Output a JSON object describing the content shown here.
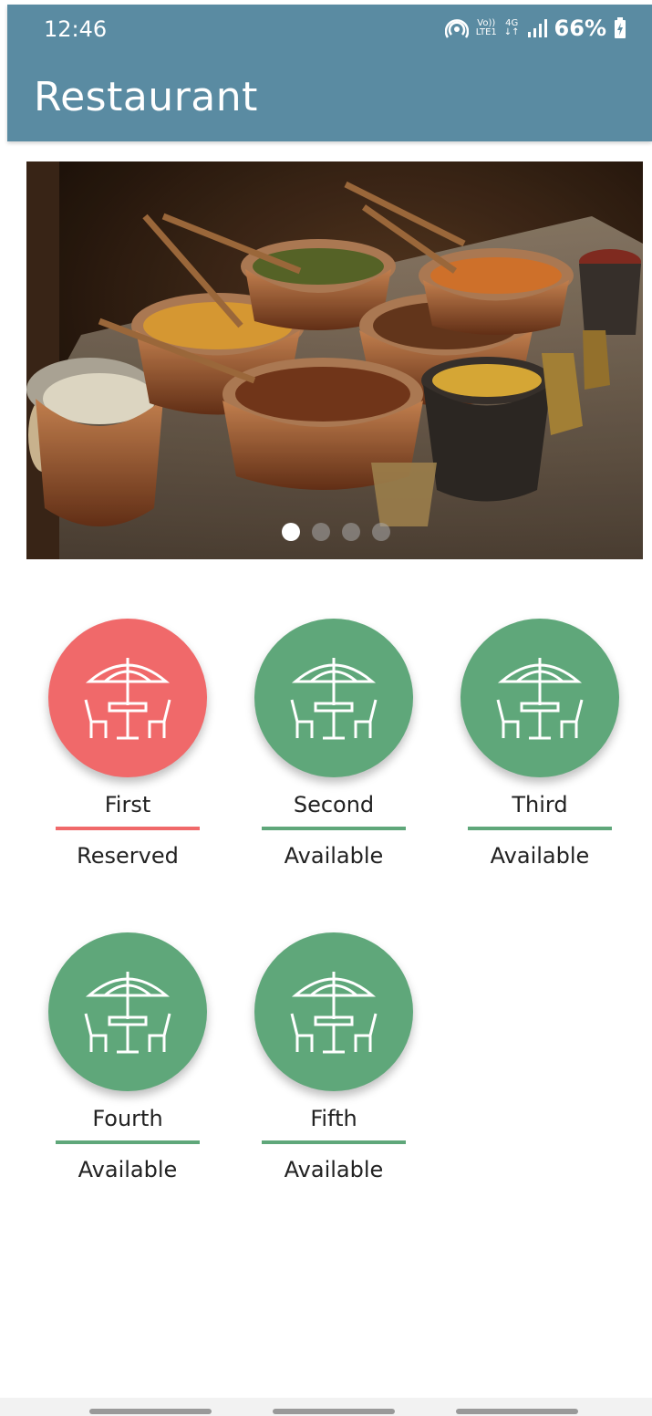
{
  "status_bar": {
    "time": "12:46",
    "volte_label": "Vo))\nLTE1",
    "network_label": "4G",
    "battery_percent": "66%"
  },
  "app_bar": {
    "title": "Restaurant"
  },
  "carousel": {
    "slide_count": 4,
    "active_index": 0,
    "image_subject": "Indian food in copper pots"
  },
  "tables": [
    {
      "name": "First",
      "status": "Reserved",
      "color": "#f0696a"
    },
    {
      "name": "Second",
      "status": "Available",
      "color": "#5fa77a"
    },
    {
      "name": "Third",
      "status": "Available",
      "color": "#5fa77a"
    },
    {
      "name": "Fourth",
      "status": "Available",
      "color": "#5fa77a"
    },
    {
      "name": "Fifth",
      "status": "Available",
      "color": "#5fa77a"
    }
  ],
  "icons": {
    "table": "restaurant-table-umbrella-icon"
  },
  "colors": {
    "appbar": "#5a8ba2",
    "available": "#5fa77a",
    "reserved": "#f0696a"
  }
}
